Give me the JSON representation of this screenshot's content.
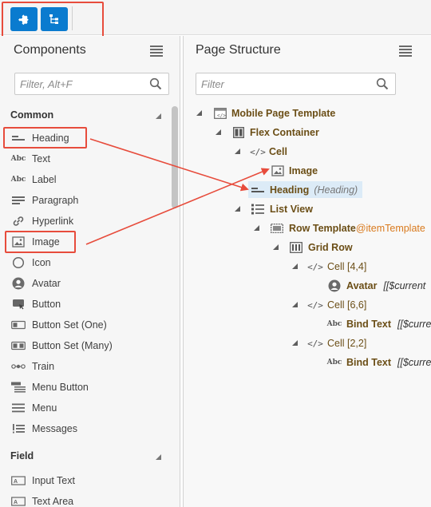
{
  "toolbar": {
    "buttons": [
      {
        "icon": "puzzle-piece-icon"
      },
      {
        "icon": "page-structure-icon"
      }
    ],
    "highlight_color": "#e74c3c",
    "button_color": "#0a7bcf"
  },
  "components_panel": {
    "title": "Components",
    "filter_placeholder": "Filter, Alt+F",
    "sections": [
      {
        "label": "Common",
        "items": [
          {
            "label": "Heading",
            "icon": "heading-icon"
          },
          {
            "label": "Text",
            "icon": "text-abc-icon"
          },
          {
            "label": "Label",
            "icon": "label-icon"
          },
          {
            "label": "Paragraph",
            "icon": "paragraph-icon"
          },
          {
            "label": "Hyperlink",
            "icon": "link-icon"
          },
          {
            "label": "Image",
            "icon": "image-icon"
          },
          {
            "label": "Icon",
            "icon": "circle-icon"
          },
          {
            "label": "Avatar",
            "icon": "avatar-icon"
          },
          {
            "label": "Button",
            "icon": "button-icon"
          },
          {
            "label": "Button Set (One)",
            "icon": "button-set-one-icon"
          },
          {
            "label": "Button Set (Many)",
            "icon": "button-set-many-icon"
          },
          {
            "label": "Train",
            "icon": "train-icon"
          },
          {
            "label": "Menu Button",
            "icon": "menu-button-icon"
          },
          {
            "label": "Menu",
            "icon": "menu-icon"
          },
          {
            "label": "Messages",
            "icon": "messages-icon"
          }
        ]
      },
      {
        "label": "Field",
        "items": [
          {
            "label": "Input Text",
            "icon": "input-text-icon"
          },
          {
            "label": "Text Area",
            "icon": "text-area-icon"
          }
        ]
      }
    ]
  },
  "structure_panel": {
    "title": "Page Structure",
    "filter_placeholder": "Filter",
    "tree": [
      {
        "label": "Mobile Page Template"
      },
      {
        "label": "Flex Container"
      },
      {
        "label": "Cell"
      },
      {
        "label": "Image"
      },
      {
        "label": "Heading",
        "sublabel": "(Heading)"
      },
      {
        "label": "List View"
      },
      {
        "label": "Row Template",
        "template": "@itemTemplate"
      },
      {
        "label": "Grid Row"
      },
      {
        "label": "Cell [4,4]"
      },
      {
        "label": "Avatar",
        "binding": "[[$current"
      },
      {
        "label": "Cell [6,6]"
      },
      {
        "label": "Bind Text",
        "binding": "[[$curre"
      },
      {
        "label": "Cell [2,2]"
      },
      {
        "label": "Bind Text",
        "binding": "[[$curre"
      }
    ]
  }
}
